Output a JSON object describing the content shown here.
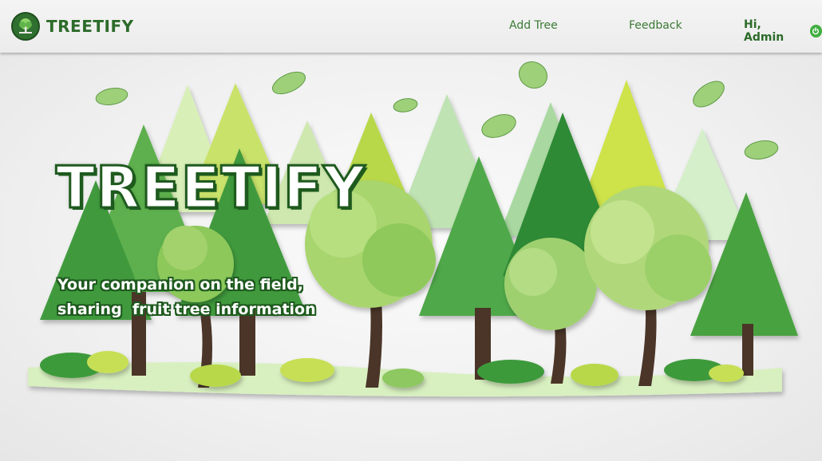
{
  "navbar": {
    "brand_name": "TREETIFY",
    "logo_icon": "tree-logo-icon",
    "links": {
      "add_tree": "Add Tree",
      "feedback": "Feedback"
    },
    "greeting": "Hi, Admin",
    "logout_icon": "power-icon"
  },
  "hero": {
    "title": "TREETIFY",
    "tagline_line1": "Your companion on the field,",
    "tagline_line2": "sharing  fruit tree information",
    "background_art": "paper-craft-forest-illustration"
  },
  "colors": {
    "brand_green": "#2d6b2a",
    "link_green": "#3b7a34",
    "power_green": "#3fae3f",
    "navbar_bg": "#f0f0f0"
  }
}
